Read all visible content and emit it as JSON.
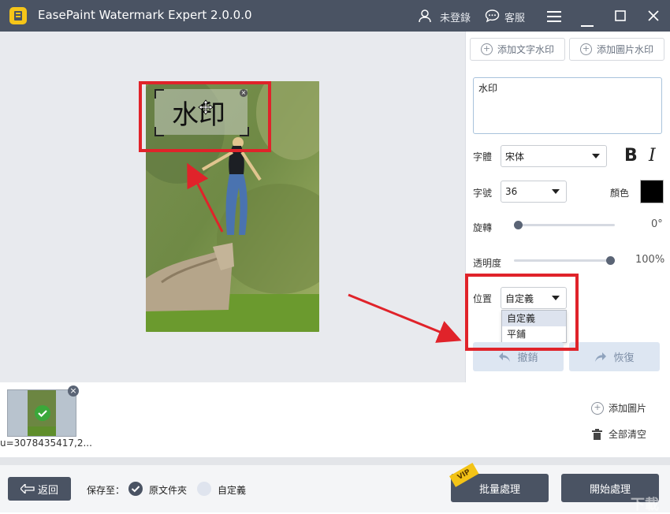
{
  "titlebar": {
    "title": "EasePaint Watermark Expert  2.0.0.0",
    "user_label": "未登錄",
    "support_label": "客服"
  },
  "toolbar": {
    "add_text_watermark": "添加文字水印",
    "add_image_watermark": "添加圖片水印"
  },
  "canvas": {
    "watermark_text": "水印"
  },
  "settings": {
    "text_value": "水印",
    "font_label": "字體",
    "font_value": "宋体",
    "bold_glyph": "B",
    "italic_glyph": "I",
    "size_label": "字號",
    "size_value": "36",
    "color_label": "顏色",
    "color_value": "#000000",
    "rotate_label": "旋轉",
    "rotate_value": "0°",
    "rotate_fraction": 0.0,
    "opacity_label": "透明度",
    "opacity_value": "100%",
    "opacity_fraction": 1.0,
    "position_label": "位置",
    "position_value": "自定義",
    "position_options": [
      "自定義",
      "平鋪"
    ],
    "undo_label": "撤銷",
    "redo_label": "恢復"
  },
  "thumbnails": {
    "file_name": "u=3078435417,2...",
    "add_image": "添加圖片",
    "clear_all": "全部清空"
  },
  "bottom": {
    "back_label": "返回",
    "save_to_label": "保存至：",
    "original_folder": "原文件夾",
    "custom": "自定義",
    "batch_label": "批量處理",
    "vip_badge": "VIP",
    "start_label": "開始處理",
    "watermark_logo": "下載"
  }
}
